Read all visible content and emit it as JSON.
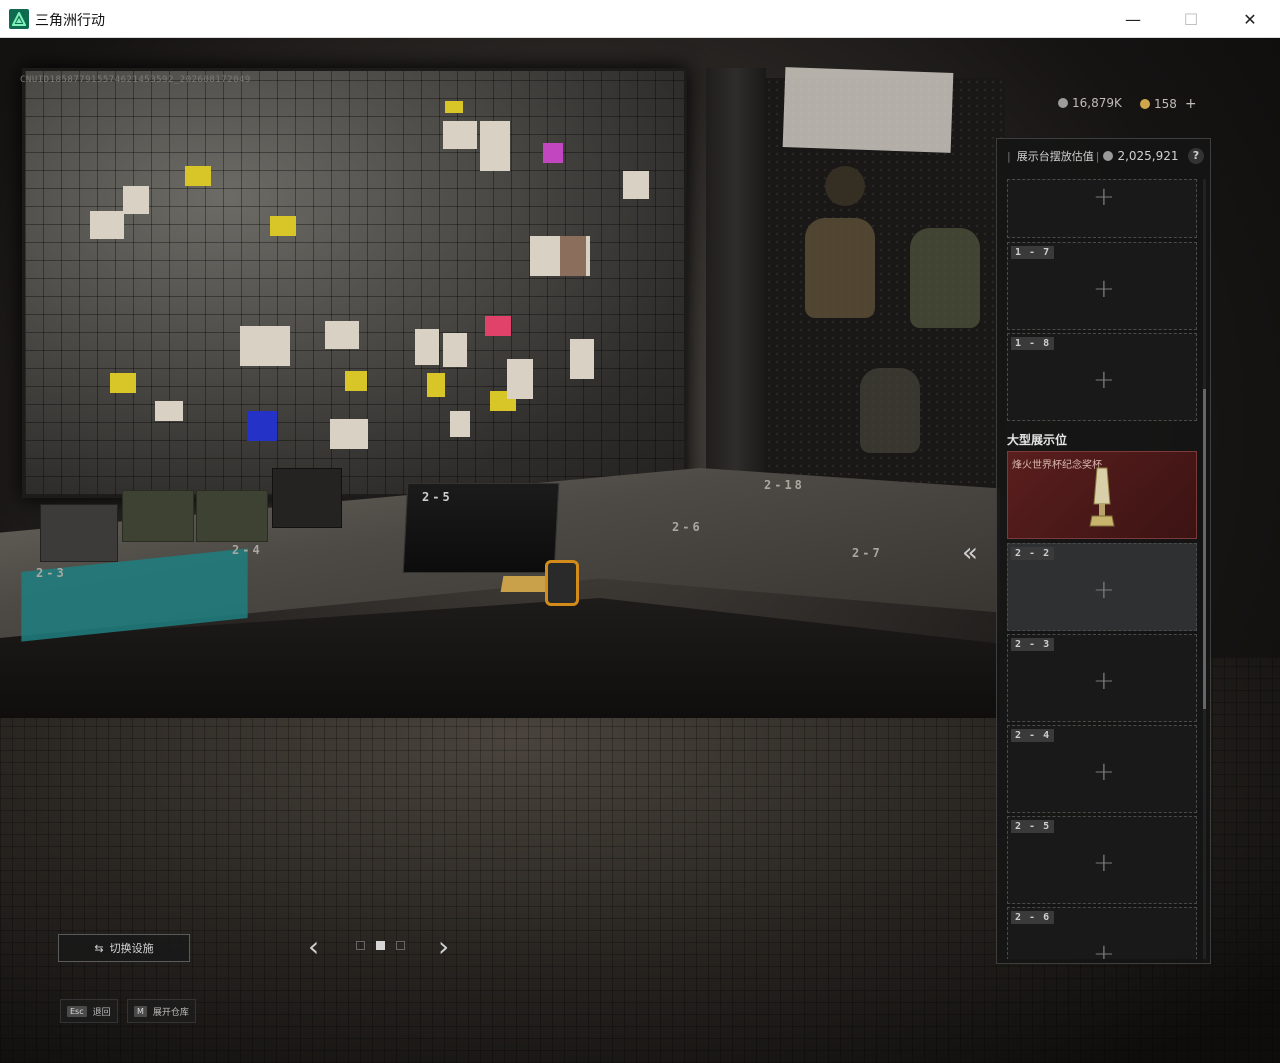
{
  "window": {
    "title": "三角洲行动",
    "minimize": "—",
    "maximize": "☐",
    "close": "✕"
  },
  "scene": {
    "uid": "CNUID185877915574621453592_202608172049",
    "marks": [
      "2-3",
      "2-4",
      "2-5",
      "2-6",
      "2-7",
      "2-18"
    ]
  },
  "currency": {
    "primary": "16,879K",
    "secondary": "158",
    "add": "+"
  },
  "panel": {
    "header_sep": "|",
    "header_label": "展示台摆放估值",
    "header_sep2": "|",
    "value": "2,025,921",
    "help": "?",
    "top_slots": [
      {
        "label": "",
        "plus": "+"
      },
      {
        "label": "1 - 7",
        "plus": "+"
      },
      {
        "label": "1 - 8",
        "plus": "+"
      }
    ],
    "large_section_title": "大型展示位",
    "trophy_slot": {
      "name": "烽火世界杯纪念奖杯"
    },
    "large_slots": [
      {
        "label": "2 - 2",
        "plus": "+"
      },
      {
        "label": "2 - 3",
        "plus": "+"
      },
      {
        "label": "2 - 4",
        "plus": "+"
      },
      {
        "label": "2 - 5",
        "plus": "+"
      },
      {
        "label": "2 - 6",
        "plus": "+"
      }
    ],
    "collapse": "«"
  },
  "controls": {
    "switch_label": "切换设施",
    "switch_icon": "⇆",
    "prev": "‹",
    "next": "›",
    "page_count": 3,
    "active_page": 2,
    "esc_key": "Esc",
    "esc_label": "退回",
    "m_key": "M",
    "m_label": "展开仓库"
  },
  "colors": {
    "accent_green": "#0f6b4f",
    "trophy_bg": "#5a1e1e",
    "panel_bg": "#141414"
  }
}
